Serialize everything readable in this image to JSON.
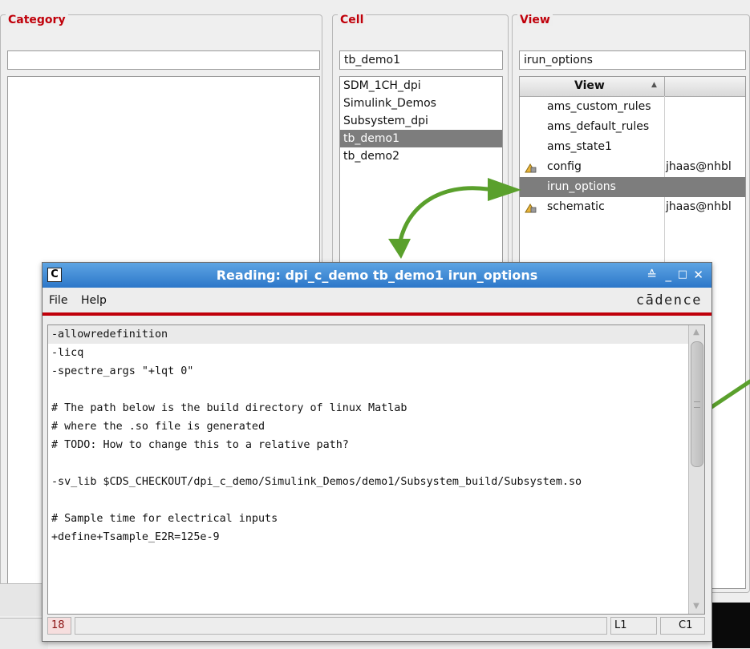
{
  "category": {
    "title": "Category",
    "filter": ""
  },
  "cell": {
    "title": "Cell",
    "filter": "tb_demo1",
    "items": [
      "SDM_1CH_dpi",
      "Simulink_Demos",
      "Subsystem_dpi",
      "tb_demo1",
      "tb_demo2"
    ],
    "selected_index": 3
  },
  "view": {
    "title": "View",
    "filter": "irun_options",
    "column_header": "View",
    "rows": [
      {
        "name": "ams_custom_rules",
        "owner": "",
        "icon": ""
      },
      {
        "name": "ams_default_rules",
        "owner": "",
        "icon": ""
      },
      {
        "name": "ams_state1",
        "owner": "",
        "icon": ""
      },
      {
        "name": "config",
        "owner": "jhaas@nhbl",
        "icon": "lock-edit-icon"
      },
      {
        "name": "irun_options",
        "owner": "",
        "icon": ""
      },
      {
        "name": "schematic",
        "owner": "jhaas@nhbl",
        "icon": "lock-edit-icon"
      }
    ],
    "selected_index": 4
  },
  "dialog": {
    "title": "Reading: dpi_c_demo tb_demo1 irun_options",
    "app_icon_letter": "C",
    "menu": {
      "file": "File",
      "help": "Help"
    },
    "brand": "cādence",
    "lines": [
      "-allowredefinition",
      "-licq",
      "-spectre_args \"+lqt 0\"",
      "",
      "# The path below is the build directory of linux Matlab",
      "# where the .so file is generated",
      "# TODO: How to change this to a relative path?",
      "",
      "-sv_lib $CDS_CHECKOUT/dpi_c_demo/Simulink_Demos/demo1/Subsystem_build/Subsystem.so",
      "",
      "# Sample time for electrical inputs",
      "+define+Tsample_E2R=125e-9"
    ],
    "status": {
      "count": "18",
      "line": "L1",
      "col": "C1"
    }
  },
  "colors": {
    "title_red": "#c0000a",
    "arrow_green": "#5aa02c",
    "titlebar_blue": "#3a86d4",
    "selection_gray": "#7d7d7d"
  }
}
